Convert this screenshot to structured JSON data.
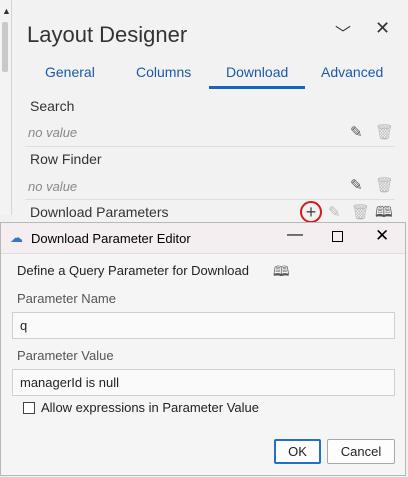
{
  "designer": {
    "title": "Layout Designer",
    "tabs": [
      {
        "label": "General"
      },
      {
        "label": "Columns"
      },
      {
        "label": "Download"
      },
      {
        "label": "Advanced"
      }
    ],
    "active_tab": "Download",
    "fields": [
      {
        "label": "Search",
        "value": "no value"
      },
      {
        "label": "Row Finder",
        "value": "no value"
      },
      {
        "label": "Download Parameters"
      }
    ]
  },
  "dialog": {
    "title": "Download Parameter Editor",
    "heading": "Define a Query Parameter for Download",
    "parameter_name_label": "Parameter Name",
    "parameter_name_value": "q",
    "parameter_value_label": "Parameter Value",
    "parameter_value_value": "managerId is null",
    "checkbox_label": "Allow expressions in Parameter Value",
    "checkbox_checked": false,
    "ok_label": "OK",
    "cancel_label": "Cancel"
  },
  "icons": {
    "edit": "pencil-icon",
    "delete": "trash-icon",
    "add": "plus-icon",
    "help": "book-icon",
    "dialog": "cloud-icon"
  },
  "colors": {
    "accent": "#1565c0",
    "highlight_circle": "#d21c1c"
  }
}
